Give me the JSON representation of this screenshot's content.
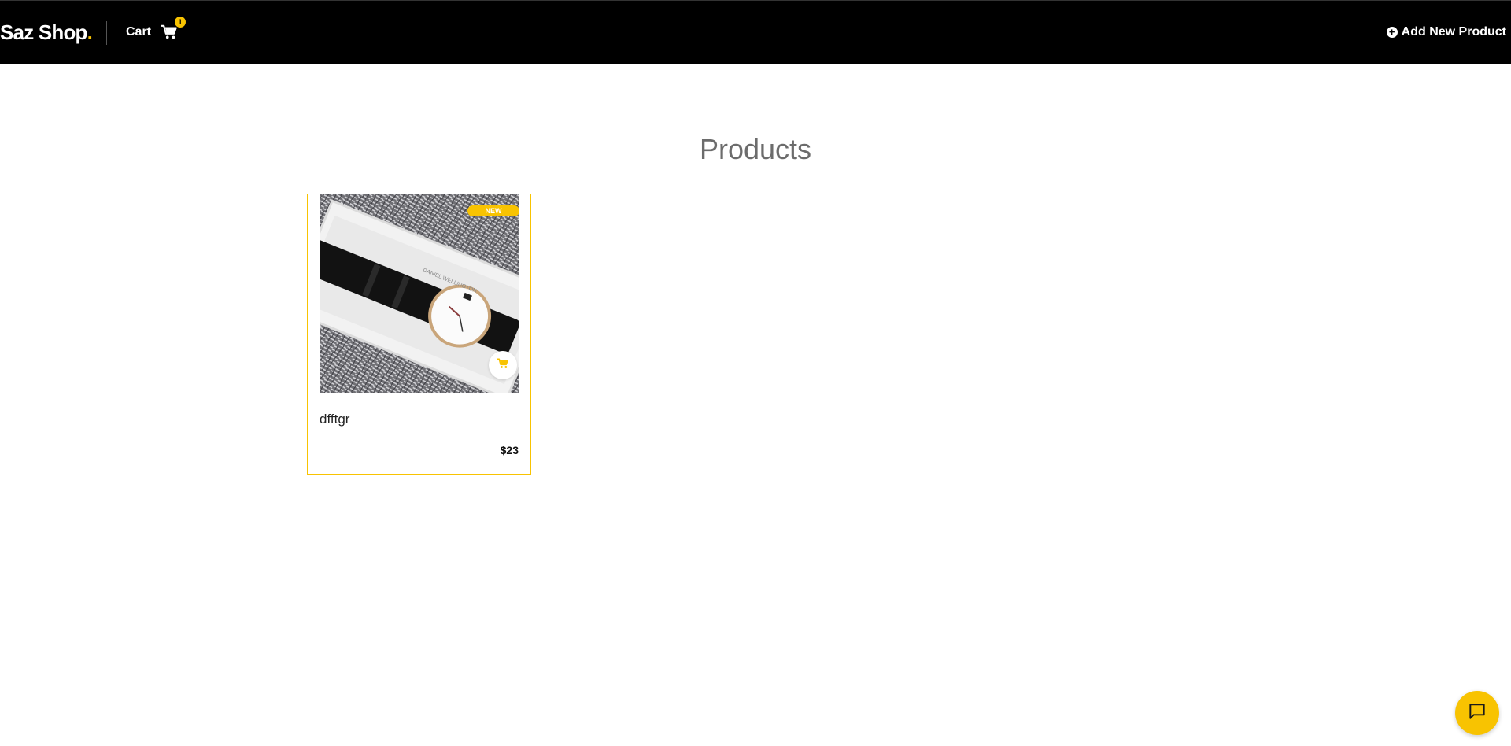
{
  "header": {
    "brand_name": "Saz Shop",
    "brand_dot": ".",
    "cart_label": "Cart",
    "cart_count": "1",
    "add_product_label": "Add New Product"
  },
  "main": {
    "title": "Products",
    "products": [
      {
        "name": "dfftgr",
        "price": "$23",
        "badge": "NEW",
        "image": "wristwatch-in-box"
      }
    ]
  },
  "icons": {
    "cart": "cart-icon",
    "add": "plus-circle-icon",
    "add_to_cart": "cart-icon",
    "chat": "chat-icon"
  },
  "colors": {
    "header_bg": "#000000",
    "accent": "#f8c301",
    "title": "#6c6c6c"
  }
}
